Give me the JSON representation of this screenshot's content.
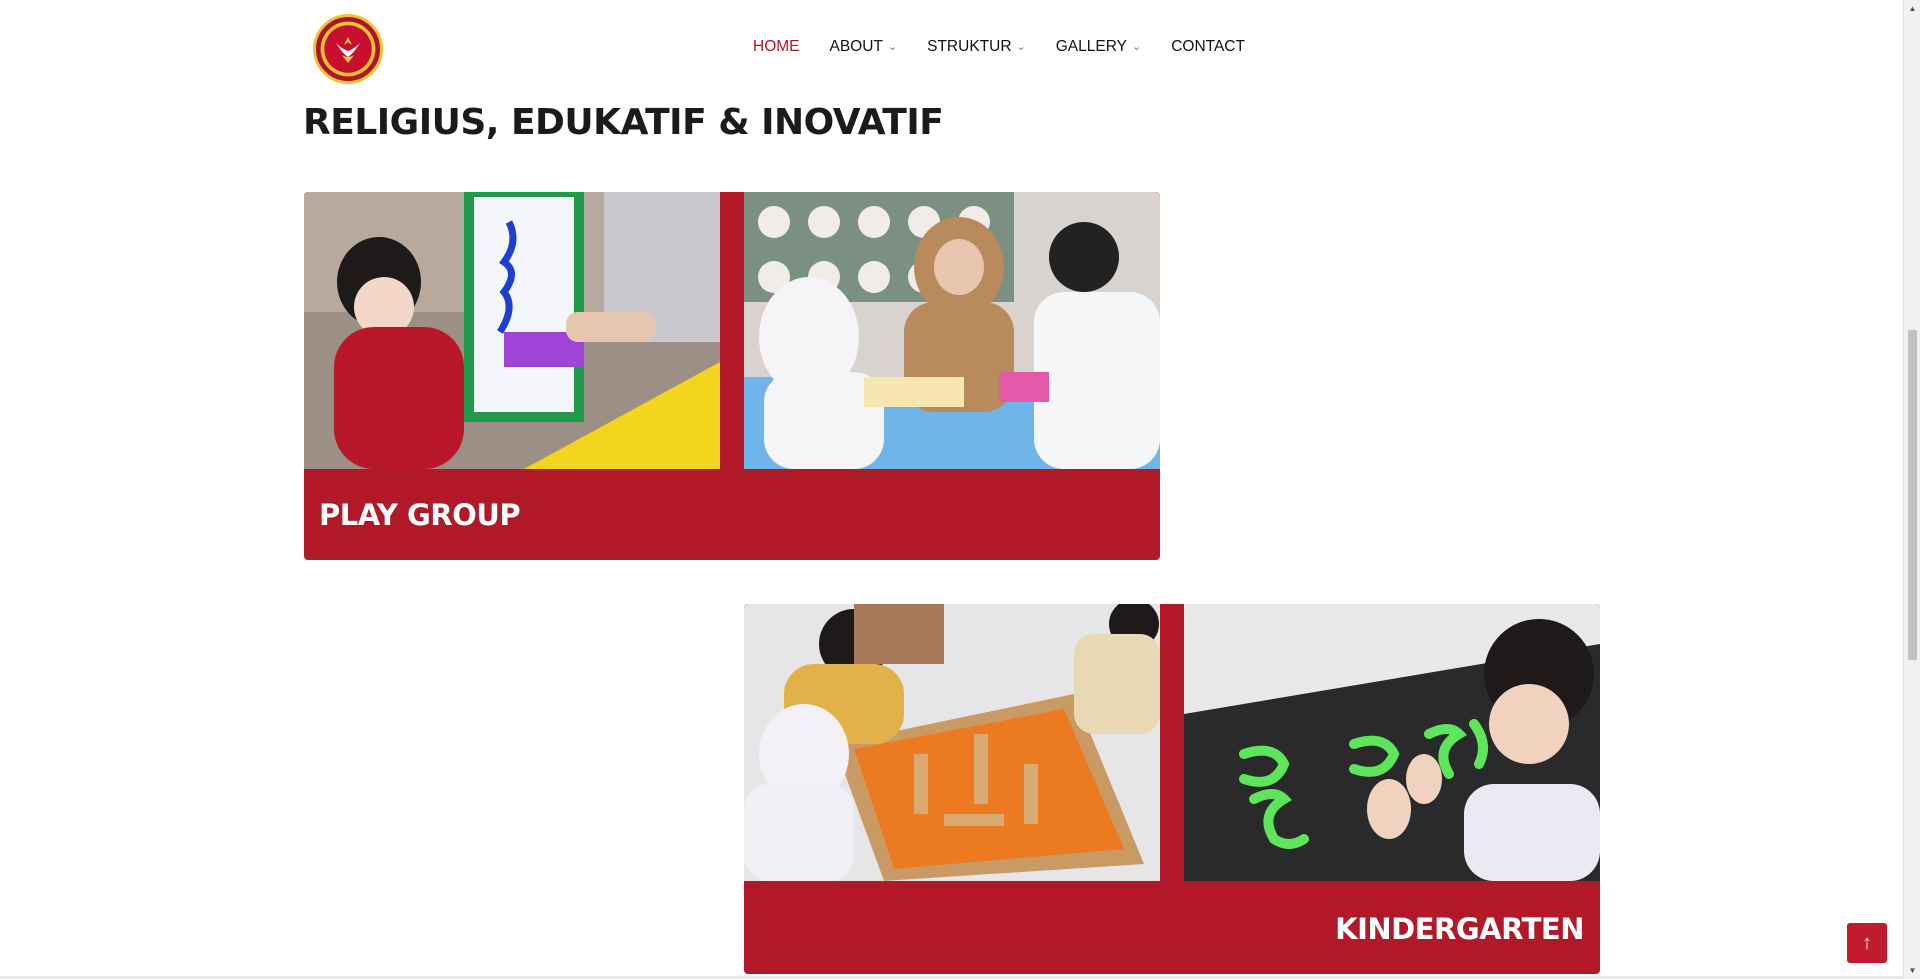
{
  "header": {
    "logo_alt": "Cendekia Islamic School",
    "nav": [
      {
        "label": "HOME",
        "active": true,
        "has_dropdown": false
      },
      {
        "label": "ABOUT",
        "active": false,
        "has_dropdown": true
      },
      {
        "label": "STRUKTUR",
        "active": false,
        "has_dropdown": true
      },
      {
        "label": "GALLERY",
        "active": false,
        "has_dropdown": true
      },
      {
        "label": "CONTACT",
        "active": false,
        "has_dropdown": false
      }
    ]
  },
  "main": {
    "heading": "RELIGIUS, EDUKATIF & INOVATIF",
    "cards": [
      {
        "title": "PLAY GROUP",
        "photos": [
          "child-painting-easel-photo",
          "teacher-with-children-photo"
        ]
      },
      {
        "title": "KINDERGARTEN",
        "photos": [
          "children-toy-town-photo",
          "child-arabic-letters-photo"
        ]
      }
    ]
  },
  "back_to_top": {
    "icon": "arrow-up-icon",
    "glyph": "↑"
  },
  "colors": {
    "accent": "#b11828",
    "nav_active": "#b11528",
    "heading": "#1b1b1b"
  }
}
